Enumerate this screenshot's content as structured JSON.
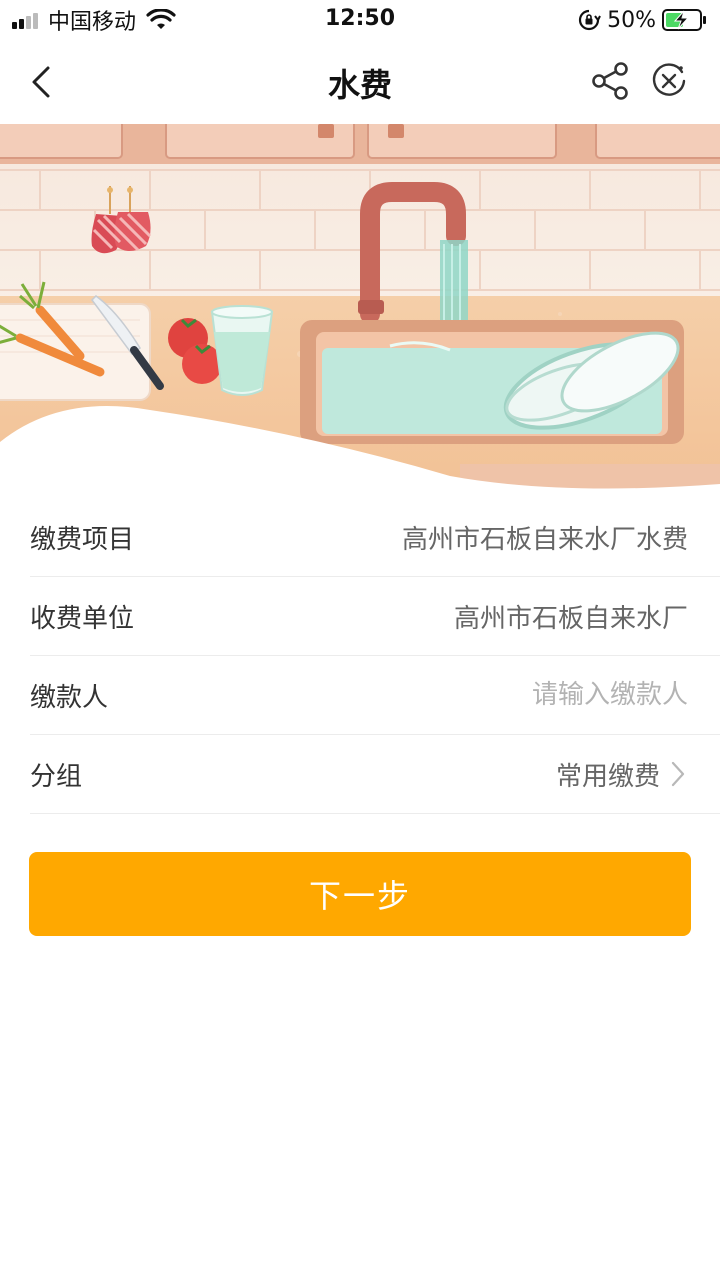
{
  "status_bar": {
    "carrier": "中国移动",
    "time": "12:50",
    "battery_percent": "50%",
    "icons": [
      "signal-icon",
      "wifi-icon",
      "orientation-lock-icon",
      "battery-charging-icon"
    ]
  },
  "nav": {
    "title": "水费",
    "icons": [
      "back-icon",
      "share-icon",
      "close-icon"
    ]
  },
  "form": {
    "rows": [
      {
        "label": "缴费项目",
        "value": "高州市石板自来水厂水费"
      },
      {
        "label": "收费单位",
        "value": "高州市石板自来水厂"
      },
      {
        "label": "缴款人",
        "value": "",
        "placeholder": "请输入缴款人"
      },
      {
        "label": "分组",
        "value": "常用缴费"
      }
    ]
  },
  "actions": {
    "next_label": "下一步"
  },
  "colors": {
    "accent": "#ffa800",
    "divider": "#ececec",
    "placeholder": "#b3b3b3"
  }
}
